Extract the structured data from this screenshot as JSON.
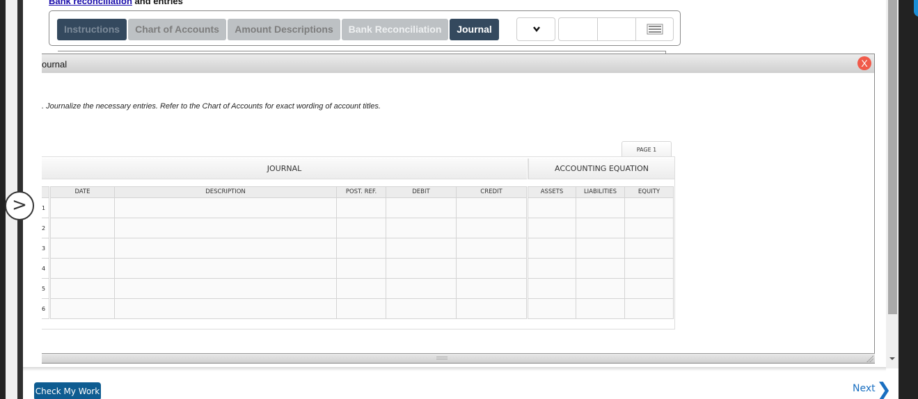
{
  "header": {
    "title_link": "Bank reconciliation",
    "title_rest": " and entries"
  },
  "tabs": [
    {
      "label": "Instructions",
      "state": "visited"
    },
    {
      "label": "Chart of Accounts",
      "state": "default"
    },
    {
      "label": "Amount Descriptions",
      "state": "default"
    },
    {
      "label": "Bank Reconciliation",
      "state": "faded"
    },
    {
      "label": "Journal",
      "state": "current"
    }
  ],
  "toolbar": {
    "dropdown_icon": "chevron-down-icon",
    "menu_icon": "list-icon"
  },
  "dialog": {
    "title": "ournal",
    "close_label": "X",
    "instruction": ". Journalize the necessary entries. Refer to the Chart of Accounts for exact wording of account titles."
  },
  "journal": {
    "page_label": "PAGE 1",
    "section_journal": "JOURNAL",
    "section_equation": "ACCOUNTING EQUATION",
    "columns": [
      "DATE",
      "DESCRIPTION",
      "POST. REF.",
      "DEBIT",
      "CREDIT",
      "ASSETS",
      "LIABILITIES",
      "EQUITY"
    ],
    "rows": [
      {
        "num": "1",
        "cells": [
          "",
          "",
          "",
          "",
          "",
          "",
          "",
          ""
        ]
      },
      {
        "num": "2",
        "cells": [
          "",
          "",
          "",
          "",
          "",
          "",
          "",
          ""
        ]
      },
      {
        "num": "3",
        "cells": [
          "",
          "",
          "",
          "",
          "",
          "",
          "",
          ""
        ]
      },
      {
        "num": "4",
        "cells": [
          "",
          "",
          "",
          "",
          "",
          "",
          "",
          ""
        ]
      },
      {
        "num": "5",
        "cells": [
          "",
          "",
          "",
          "",
          "",
          "",
          "",
          ""
        ]
      },
      {
        "num": "6",
        "cells": [
          "",
          "",
          "",
          "",
          "",
          "",
          "",
          ""
        ]
      }
    ]
  },
  "side_toggle": ">",
  "footer": {
    "check_label": "Check My Work",
    "next_label": "Next",
    "next_icon": "❯"
  }
}
